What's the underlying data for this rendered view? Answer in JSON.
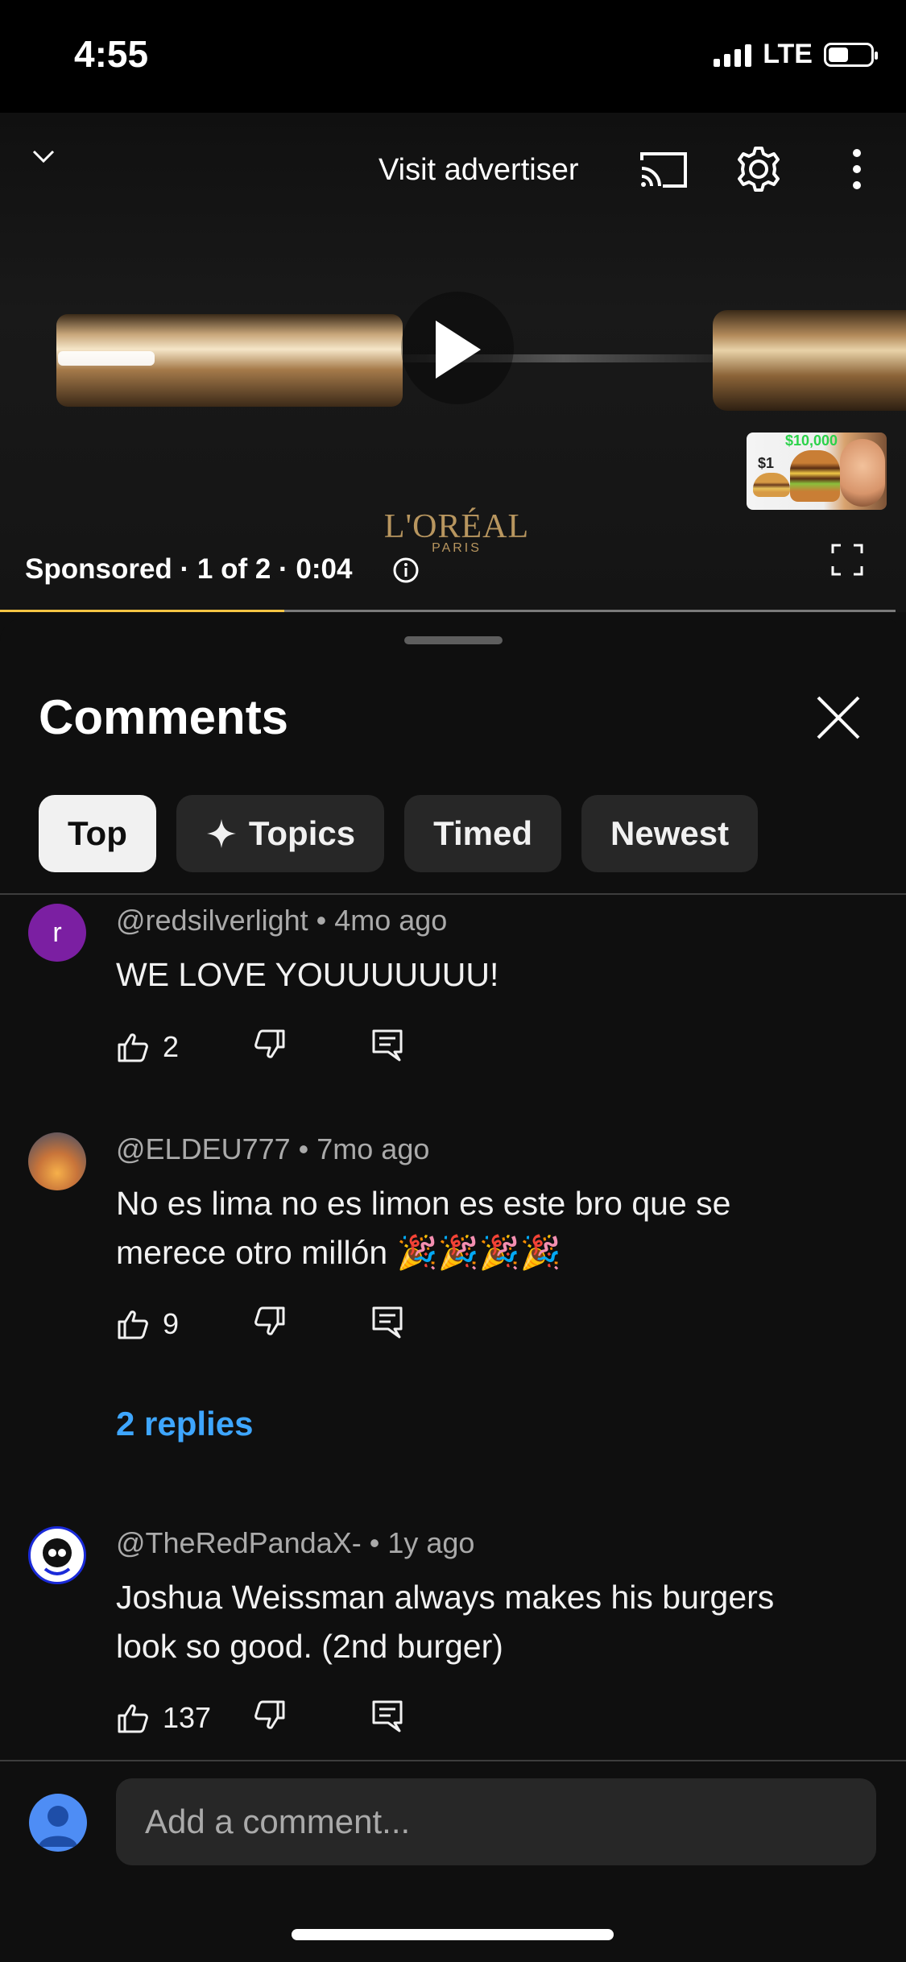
{
  "status_bar": {
    "time": "4:55",
    "network": "LTE"
  },
  "video": {
    "visit_advertiser": "Visit advertiser",
    "brand": "L'ORÉAL",
    "brand_sub": "PARIS",
    "ad_info": "Sponsored · 1 of 2 · 0:04",
    "progress": 0.317,
    "thumbnail": {
      "price_low": "$1",
      "price_high": "$10,000"
    }
  },
  "comments_panel": {
    "title": "Comments",
    "filters": [
      {
        "label": "Top",
        "active": true
      },
      {
        "label": "Topics",
        "active": false,
        "icon": "sparkle-icon"
      },
      {
        "label": "Timed",
        "active": false
      },
      {
        "label": "Newest",
        "active": false
      }
    ],
    "comments": [
      {
        "author": "@redsilverlight",
        "age": "4mo ago",
        "text": "WE LOVE YOUUUUUUU!",
        "likes": "2",
        "avatar_letter": "r",
        "avatar_color": "#7b1fa2"
      },
      {
        "author": "@ELDEU777",
        "age": "7mo ago",
        "text": "No es lima no es limon es este bro que se merece otro millón 🎉🎉🎉🎉",
        "likes": "9",
        "replies": "2 replies"
      },
      {
        "author": "@TheRedPandaX-",
        "age": "1y ago",
        "text": "Joshua Weissman always makes his burgers look so good. (2nd burger)",
        "likes": "137"
      }
    ],
    "add_comment_placeholder": "Add a comment..."
  },
  "colors": {
    "accent_link": "#3ea6ff",
    "progress": "#f6c544",
    "background": "#0f0f0f"
  }
}
